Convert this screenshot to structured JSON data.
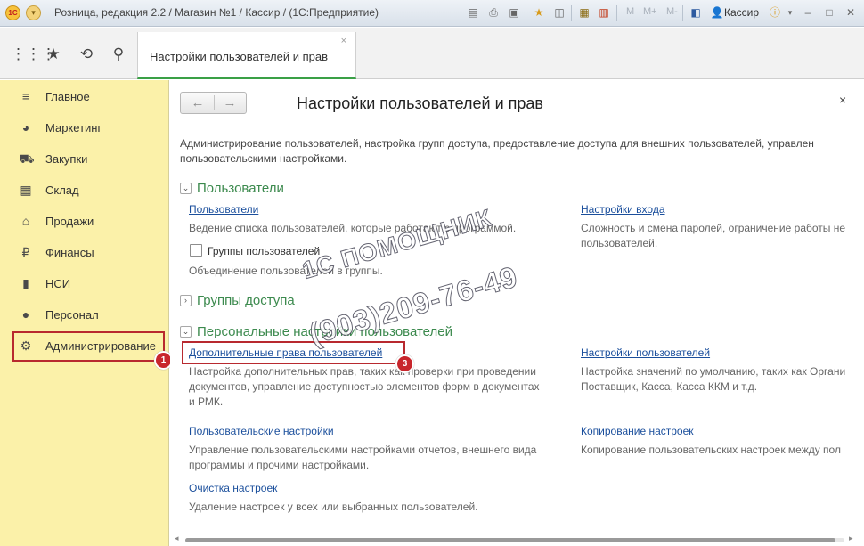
{
  "window": {
    "title": "Розница, редакция 2.2 / Магазин №1 / Кассир /  (1С:Предприятие)",
    "logo_text": "1С",
    "user": "Кассир",
    "m_buttons": [
      "M",
      "M+",
      "M-"
    ]
  },
  "toolbar": {
    "tab_label": "Настройки пользователей и прав",
    "tab_close": "×"
  },
  "sidebar": {
    "items": [
      {
        "label": "Главное",
        "icon": "menu-lines-icon"
      },
      {
        "label": "Маркетинг",
        "icon": "pie-chart-icon"
      },
      {
        "label": "Закупки",
        "icon": "cart-icon"
      },
      {
        "label": "Склад",
        "icon": "warehouse-grid-icon"
      },
      {
        "label": "Продажи",
        "icon": "basket-icon"
      },
      {
        "label": "Финансы",
        "icon": "ruble-coin-icon"
      },
      {
        "label": "НСИ",
        "icon": "reference-book-icon"
      },
      {
        "label": "Персонал",
        "icon": "person-icon"
      },
      {
        "label": "Администрирование",
        "icon": "gear-icon"
      }
    ],
    "active_index": 8
  },
  "badges": {
    "sidebar": "1",
    "link": "3"
  },
  "main": {
    "title": "Настройки пользователей и прав",
    "close": "×",
    "description": "Администрирование пользователей, настройка групп доступа, предоставление доступа для внешних пользователей, управлен пользовательскими настройками.",
    "groups": {
      "users": {
        "title": "Пользователи",
        "users_link": "Пользователи",
        "users_note": "Ведение списка пользователей, которые работают с программой.",
        "user_groups_checkbox": "Группы пользователей",
        "user_groups_checked": false,
        "user_groups_note": "Объединение пользователей в группы.",
        "login_link": "Настройки входа",
        "login_note": "Сложность и смена паролей, ограничение работы не пользователей."
      },
      "access": {
        "title": "Группы доступа"
      },
      "personal": {
        "title": "Персональные настройки пользователей",
        "extra_rights_link": "Дополнительные права пользователей",
        "extra_rights_note": "Настройка дополнительных прав, таких как проверки при проведении документов, управление доступностью элементов форм в документах и РМК.",
        "user_settings_link": "Настройки пользователей",
        "user_settings_note": "Настройка значений по умолчанию, таких как Органи Поставщик, Касса, Касса ККМ и т.д.",
        "personal_settings_link": "Пользовательские настройки",
        "personal_settings_note": "Управление пользовательскими настройками отчетов, внешнего вида программы и прочими настройками.",
        "copy_settings_link": "Копирование настроек",
        "copy_settings_note": "Копирование пользовательских настроек между пол",
        "clear_settings_link": "Очистка настроек",
        "clear_settings_note": "Удаление настроек у всех или выбранных пользователей."
      }
    }
  },
  "watermark": {
    "line1": "1С ПОМОЩНИК",
    "line2": "(903)209-76-49"
  }
}
